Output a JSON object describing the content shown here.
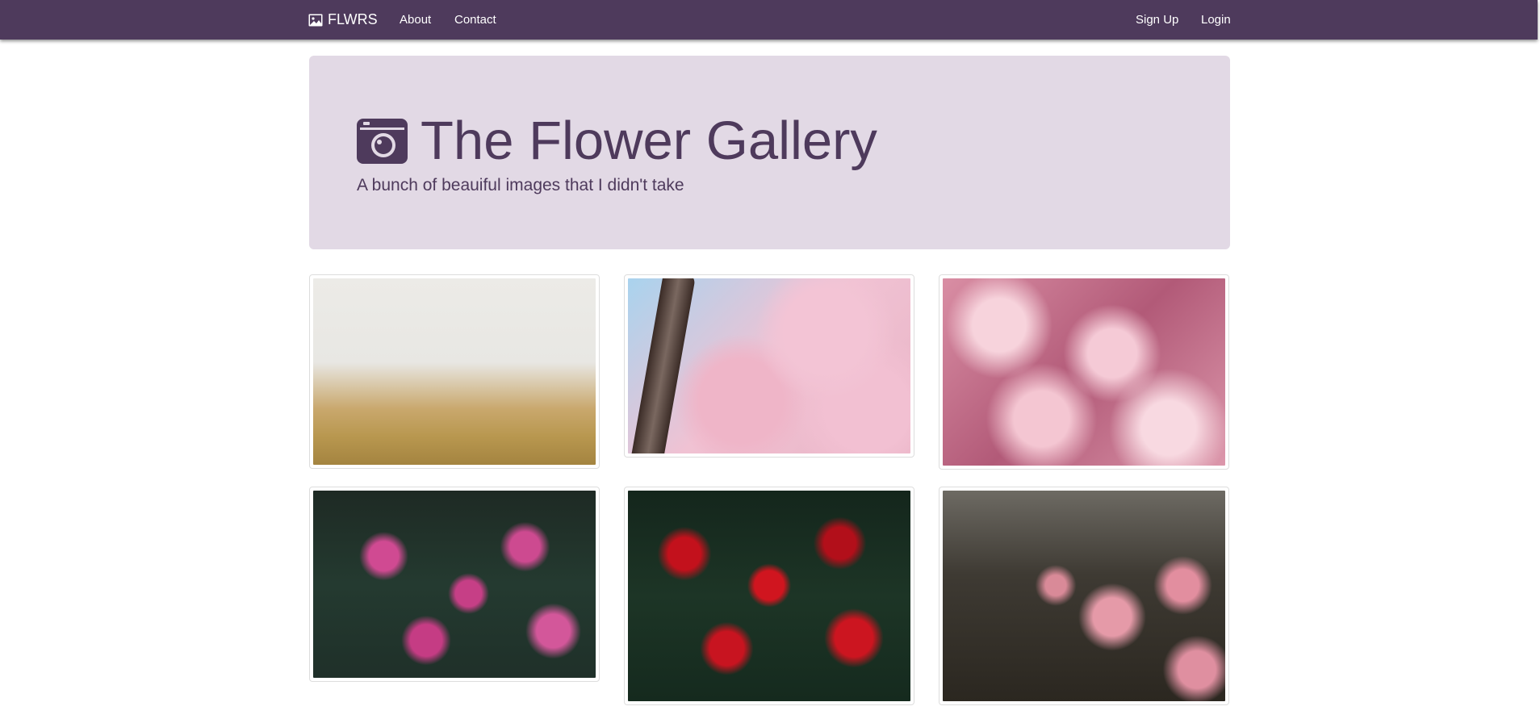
{
  "navbar": {
    "brand": "FLWRS",
    "brand_icon": "image-icon",
    "links_left": [
      "About",
      "Contact"
    ],
    "links_right": [
      "Sign Up",
      "Login"
    ],
    "background": "#4e3a5c"
  },
  "jumbotron": {
    "icon": "camera-icon",
    "title": "The Flower Gallery",
    "subtitle": "A bunch of beauiful images that I didn't take",
    "background": "#e2d9e5",
    "text_color": "#4e3a5c"
  },
  "gallery": {
    "images": [
      {
        "subject": "poppy field"
      },
      {
        "subject": "cherry blossoms"
      },
      {
        "subject": "pink peonies"
      },
      {
        "subject": "pink tulips"
      },
      {
        "subject": "red roses"
      },
      {
        "subject": "pink camellias"
      }
    ]
  }
}
